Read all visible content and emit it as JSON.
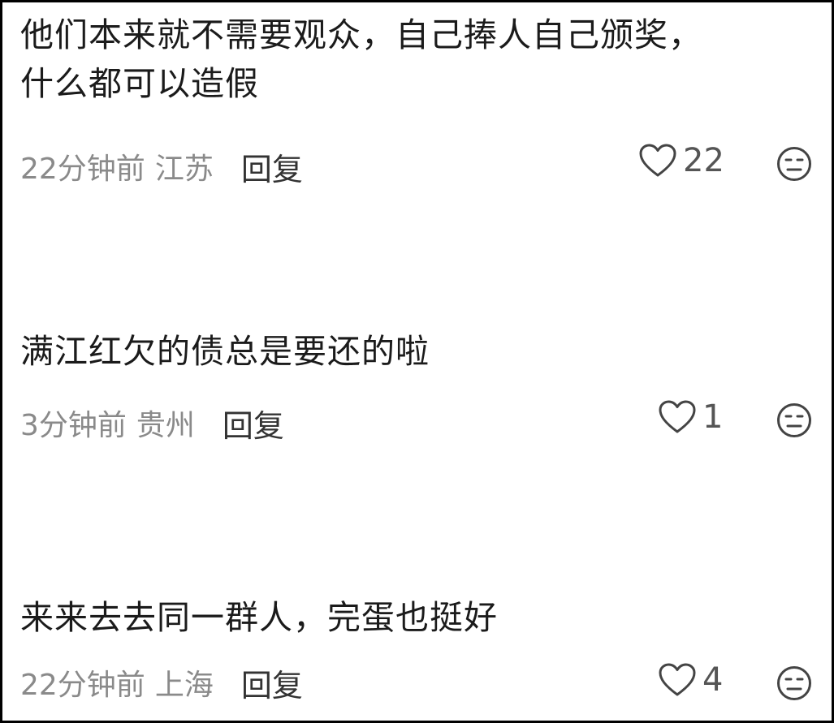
{
  "comments": [
    {
      "text": "他们本来就不需要观众，自己捧人自己颁奖，\n什么都可以造假",
      "time": "22分钟前",
      "region": "江苏",
      "reply_label": "回复",
      "likes": "22",
      "like_icon": "heart-outline-icon",
      "dislike_icon": "neutral-face-icon"
    },
    {
      "text": "满江红欠的债总是要还的啦",
      "time": "3分钟前",
      "region": "贵州",
      "reply_label": "回复",
      "likes": "1",
      "like_icon": "heart-outline-icon",
      "dislike_icon": "neutral-face-icon"
    },
    {
      "text": "来来去去同一群人，完蛋也挺好",
      "time": "22分钟前",
      "region": "上海",
      "reply_label": "回复",
      "likes": "4",
      "like_icon": "heart-outline-icon",
      "dislike_icon": "neutral-face-icon"
    }
  ],
  "colors": {
    "text": "#1b1b1b",
    "meta": "#8a8a8a",
    "icon": "#444444",
    "border": "#000000"
  }
}
